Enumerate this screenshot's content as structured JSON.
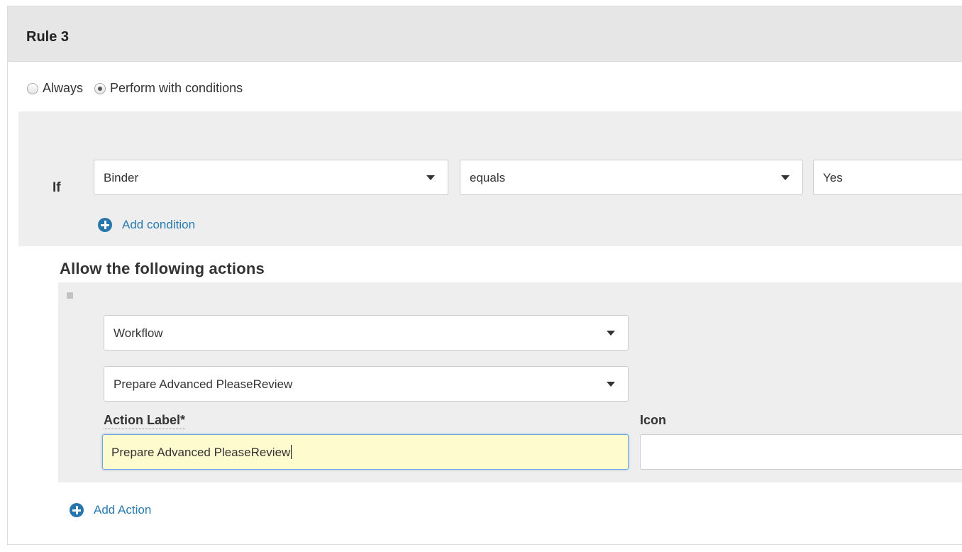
{
  "rule": {
    "title": "Rule 3",
    "modes": [
      {
        "label": "Always",
        "selected": false
      },
      {
        "label": "Perform with conditions",
        "selected": true
      }
    ]
  },
  "condition": {
    "if_label": "If",
    "field": "Binder",
    "operator": "equals",
    "value": "Yes",
    "add_condition_label": "Add condition"
  },
  "actions": {
    "heading": "Allow the following actions",
    "action_type": "Workflow",
    "action_value": "Prepare Advanced PleaseReview",
    "action_label_title": "Action Label*",
    "action_label_value": "Prepare Advanced PleaseReview",
    "icon_title": "Icon",
    "icon_value": "",
    "add_action_label": "Add Action"
  },
  "colors": {
    "link": "#2a7ab0",
    "plus_icon": "#2775ad",
    "focused_input_bg": "#fefbcf",
    "panel_header_bg": "#e6e6e6",
    "section_bg": "#eeeeee"
  }
}
